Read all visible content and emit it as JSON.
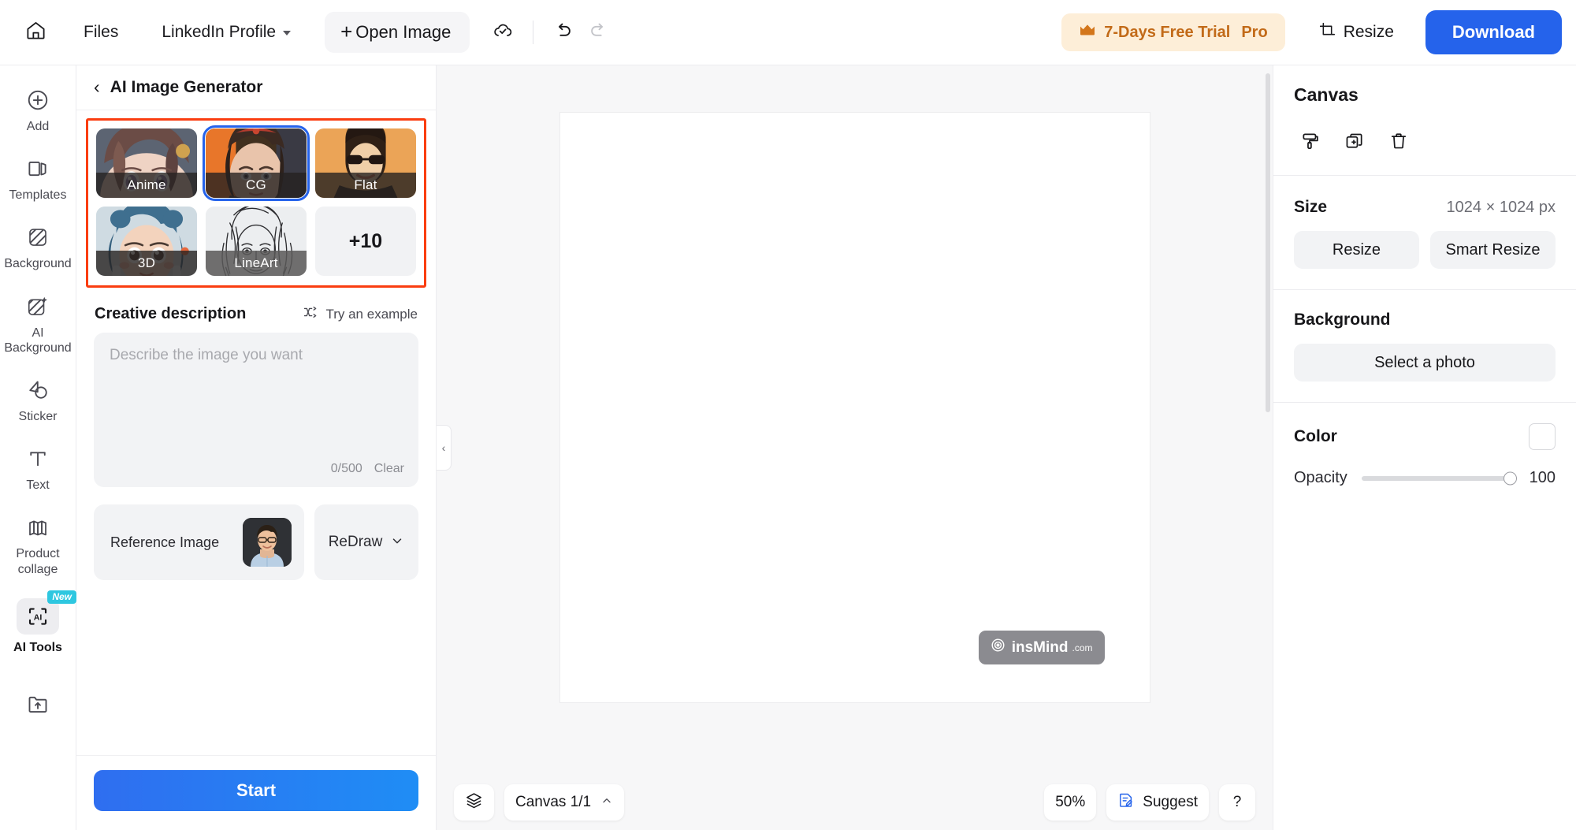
{
  "topbar": {
    "home_icon": "home-icon",
    "files_label": "Files",
    "project_name": "LinkedIn Profile",
    "project_chevron_icon": "chevron-down-icon",
    "open_image_label": "Open Image",
    "open_image_plus": "+",
    "cloud_save_icon": "cloud-check-icon",
    "undo_icon": "undo-icon",
    "redo_icon": "redo-icon",
    "trial_label": "7-Days Free Trial",
    "trial_pro": "Pro",
    "crown_icon": "crown-icon",
    "resize_label": "Resize",
    "resize_icon": "crop-resize-icon",
    "download_label": "Download",
    "trial_bg_color": "#fdeed8",
    "trial_text_color": "#c26a18",
    "download_color": "#2563eb"
  },
  "rail": {
    "items": [
      {
        "label": "Add",
        "icon": "plus-circle-icon",
        "active": false
      },
      {
        "label": "Templates",
        "icon": "templates-icon",
        "active": false
      },
      {
        "label": "Background",
        "icon": "background-hatch-icon",
        "active": false
      },
      {
        "label": "AI Background",
        "icon": "ai-background-sparkle-icon",
        "active": false
      },
      {
        "label": "Sticker",
        "icon": "sticker-icon",
        "active": false
      },
      {
        "label": "Text",
        "icon": "text-t-icon",
        "active": false
      },
      {
        "label": "Product collage",
        "icon": "product-collage-icon",
        "active": false
      },
      {
        "label": "AI Tools",
        "icon": "ai-tools-icon",
        "active": true,
        "badge": "New"
      }
    ],
    "upload_icon": "upload-folder-icon",
    "badge_color": "#2ec7e0"
  },
  "panel": {
    "back_icon": "chevron-left-icon",
    "title": "AI Image Generator",
    "highlight_color": "#fa3d10",
    "selected_style_outline": "#2563eb",
    "styles": [
      {
        "label": "Anime",
        "selected": false,
        "art": "anime"
      },
      {
        "label": "CG",
        "selected": true,
        "art": "cg"
      },
      {
        "label": "Flat",
        "selected": false,
        "art": "flat"
      },
      {
        "label": "3D",
        "selected": false,
        "art": "threed"
      },
      {
        "label": "LineArt",
        "selected": false,
        "art": "lineart"
      },
      {
        "label": "+10",
        "selected": false,
        "art": "more"
      }
    ],
    "creative_description_title": "Creative description",
    "try_example_label": "Try an example",
    "try_example_icon": "shuffle-icon",
    "prompt_placeholder": "Describe the image you want",
    "prompt_value": "",
    "char_count": "0/500",
    "clear_label": "Clear",
    "reference_image_label": "Reference Image",
    "reference_thumb_icon": "person-photo-thumbnail",
    "redraw_label": "ReDraw",
    "redraw_chevron_icon": "chevron-down-icon",
    "start_label": "Start"
  },
  "stage": {
    "collapse_icon": "chevron-left-icon",
    "watermark_text": "insMind",
    "watermark_domain": ".com",
    "watermark_icon": "insmind-logo-icon",
    "layers_icon": "layers-icon",
    "canvas_pager_label": "Canvas 1/1",
    "canvas_pager_caret": "caret-up-icon",
    "zoom_label": "50%",
    "suggest_label": "Suggest",
    "suggest_icon": "suggest-note-icon",
    "help_label": "?"
  },
  "props": {
    "title": "Canvas",
    "tool_icons": [
      {
        "name": "paint-roller-icon"
      },
      {
        "name": "duplicate-add-icon"
      },
      {
        "name": "trash-icon"
      }
    ],
    "size_label": "Size",
    "size_value": "1024 × 1024 px",
    "resize_label": "Resize",
    "smart_resize_label": "Smart Resize",
    "background_label": "Background",
    "select_photo_label": "Select a photo",
    "color_label": "Color",
    "color_value": "#ffffff",
    "opacity_label": "Opacity",
    "opacity_value": "100"
  }
}
